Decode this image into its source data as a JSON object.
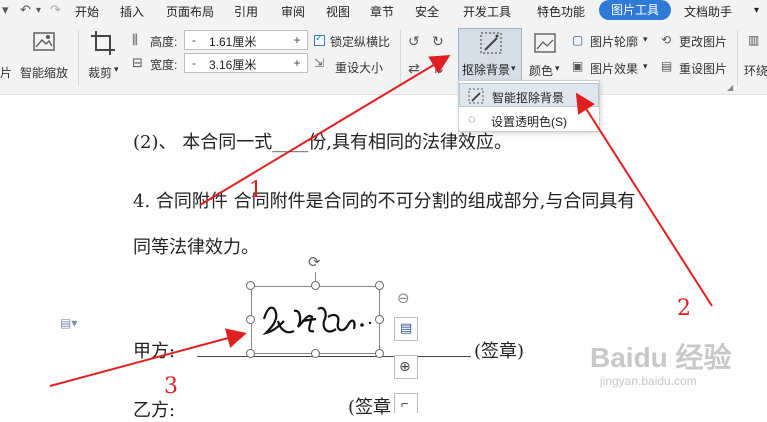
{
  "menu": {
    "items": [
      "开始",
      "插入",
      "页面布局",
      "引用",
      "审阅",
      "视图",
      "章节",
      "安全",
      "开发工具",
      "特色功能"
    ],
    "active": "图片工具",
    "right": "文档助手"
  },
  "ribbon": {
    "smart_zoom": "智能缩放",
    "crop": "裁剪",
    "height_label": "高度:",
    "height_value": "1.61厘米",
    "width_label": "宽度:",
    "width_value": "3.16厘米",
    "minus": "-",
    "plus": "+",
    "lock_ratio": "锁定纵横比",
    "reset_size": "重设大小",
    "remove_bg": "抠除背景",
    "color": "颜色",
    "outline": "图片轮廓",
    "effect": "图片效果",
    "change_pic": "更改图片",
    "reset_pic": "重设图片",
    "wrap": "环绕",
    "left_cut": "片"
  },
  "dropdown": {
    "items": [
      "智能抠除背景",
      "设置透明色(S)"
    ]
  },
  "document": {
    "line1": "(2)、  本合同一式____份,具有相同的法律效应。",
    "line2": "4. 合同附件  合同附件是合同的不可分割的组成部分,与合同具有",
    "line3": "同等法律效力。",
    "party_a": "甲方:",
    "seal_a": "(签章)",
    "party_b": "乙方:",
    "seal_b": "(签章"
  },
  "annotations": {
    "n1": "1",
    "n2": "2",
    "n3": "3"
  },
  "watermark": {
    "brand": "Baidu 经验",
    "url": "jingyan.baidu.com"
  },
  "colors": {
    "accent": "#2f7ad6",
    "arrow": "#e02020"
  }
}
